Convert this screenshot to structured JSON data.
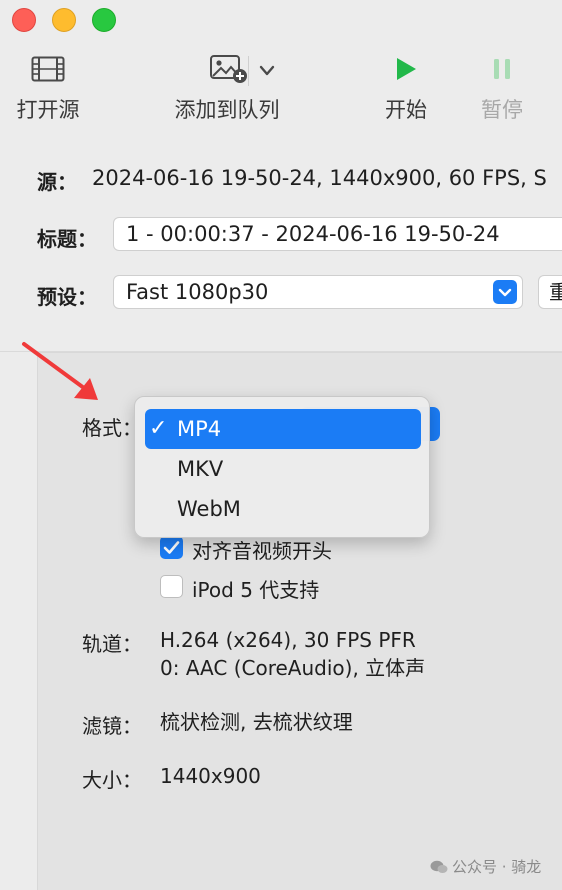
{
  "toolbar": {
    "open_source": "打开源",
    "add_to_queue": "添加到队列",
    "start": "开始",
    "pause": "暂停"
  },
  "source": {
    "label": "源：",
    "value": "2024-06-16 19-50-24, 1440x900, 60 FPS, S"
  },
  "title": {
    "label": "标题：",
    "value": "1 - 00:00:37 - 2024-06-16 19-50-24"
  },
  "preset": {
    "label": "预设：",
    "value": "Fast 1080p30",
    "edge_button": "重"
  },
  "format": {
    "label": "格式：",
    "menu": [
      {
        "label": "MP4",
        "selected": true
      },
      {
        "label": "MKV",
        "selected": false
      },
      {
        "label": "WebM",
        "selected": false
      }
    ],
    "check_mark": "✓"
  },
  "options": {
    "align_av": "对齐音视频开头",
    "ipod": "iPod 5 代支持"
  },
  "tracks": {
    "label": "轨道：",
    "line1": "H.264 (x264), 30 FPS PFR",
    "line2": "0: AAC (CoreAudio), 立体声"
  },
  "filters": {
    "label": "滤镜：",
    "value": "梳状检测, 去梳状纹理"
  },
  "size": {
    "label": "大小：",
    "value": "1440x900"
  },
  "watermark": "公众号 · 骑龙",
  "colors": {
    "accent": "#1b7cf5",
    "play_green": "#22b84a",
    "annotation_red": "#f03a3a"
  }
}
